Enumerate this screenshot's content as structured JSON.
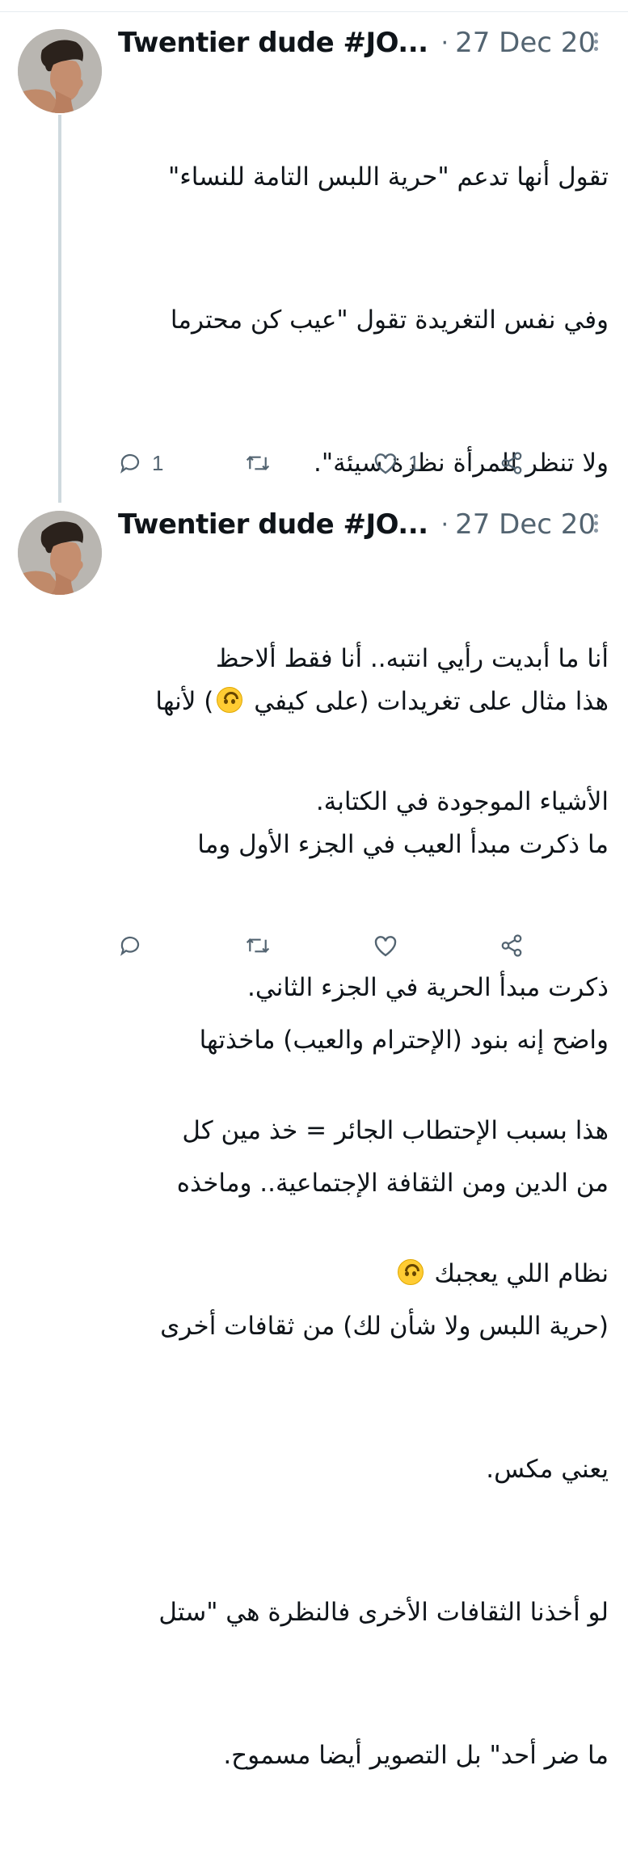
{
  "tweets": [
    {
      "author": "Twentier dude #JO...",
      "separator": "·",
      "date": "27 Dec 20",
      "lines": [
        "تقول أنها تدعم \"حرية اللبس التامة للنساء\"",
        "وفي نفس التغريدة تقول \"عيب كن محترما",
        "ولا تنظر للمرأة نظرة سيئة\".",
        "",
        "هذا مثال على تغريدات (على كيفي 🙃) لأنها",
        "ما ذكرت مبدأ العيب في الجزء الأول وما",
        "ذكرت مبدأ الحرية في الجزء الثاني.",
        "هذا بسبب الإحتطاب الجائر = خذ مين كل",
        "نظام اللي يعجبك 🙃"
      ],
      "reply_count": "1",
      "retweet_count": "",
      "like_count": "1"
    },
    {
      "author": "Twentier dude #JO...",
      "separator": "·",
      "date": "27 Dec 20",
      "lines": [
        "أنا ما أبديت رأيي انتبه.. أنا فقط ألاحظ",
        "الأشياء الموجودة في الكتابة.",
        "",
        "واضح إنه بنود (الإحترام والعيب) ماخذتها",
        "من الدين ومن الثقافة الإجتماعية.. وماخذه",
        "(حرية اللبس ولا شأن لك) من ثقافات أخرى",
        "يعني مكس.",
        "لو أخذنا الثقافات الأخرى فالنظرة هي \"ستل",
        "ما ضر أحد\" بل التصوير أيضا مسموح."
      ],
      "reply_count": "",
      "retweet_count": "",
      "like_count": ""
    }
  ],
  "icons": {
    "reply": "reply-icon",
    "retweet": "retweet-icon",
    "like": "heart-icon",
    "share": "share-icon",
    "more": "more-options-icon",
    "emoji": "upside-down-face-emoji"
  },
  "colors": {
    "text": "#0f1419",
    "secondary": "#536471",
    "thread_line": "#cfd9de"
  }
}
